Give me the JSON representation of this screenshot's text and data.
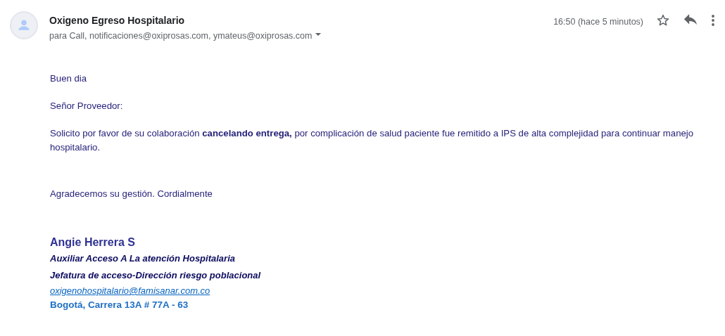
{
  "header": {
    "sender": "Oxigeno Egreso Hospitalario",
    "recipients": "para Call, notificaciones@oxiprosas.com, ymateus@oxiprosas.com",
    "time": "16:50 (hace 5 minutos)",
    "starred": false
  },
  "body": [
    "Buen dia",
    "Señor Proveedor:",
    "Solicito por favor de su colaboración **cancelando entrega,** por complicación de salud paciente fue remitido a IPS de alta complejidad para continuar manejo hospitalario.",
    "Agradecemos su gestión. Cordialmente"
  ],
  "signature": [
    {
      "kind": "name",
      "text": "Angie Herrera S"
    },
    {
      "kind": "title",
      "text": "Auxiliar Acceso A La atención Hospitalaria"
    },
    {
      "kind": "title",
      "text": "Jefatura de acceso-Dirección riesgo poblacional"
    },
    {
      "kind": "email",
      "text": "oxigenohospitalario@famisanar.com.co"
    },
    {
      "kind": "address",
      "text": "Bogotá, Carrera 13A # 77A - 63"
    }
  ]
}
